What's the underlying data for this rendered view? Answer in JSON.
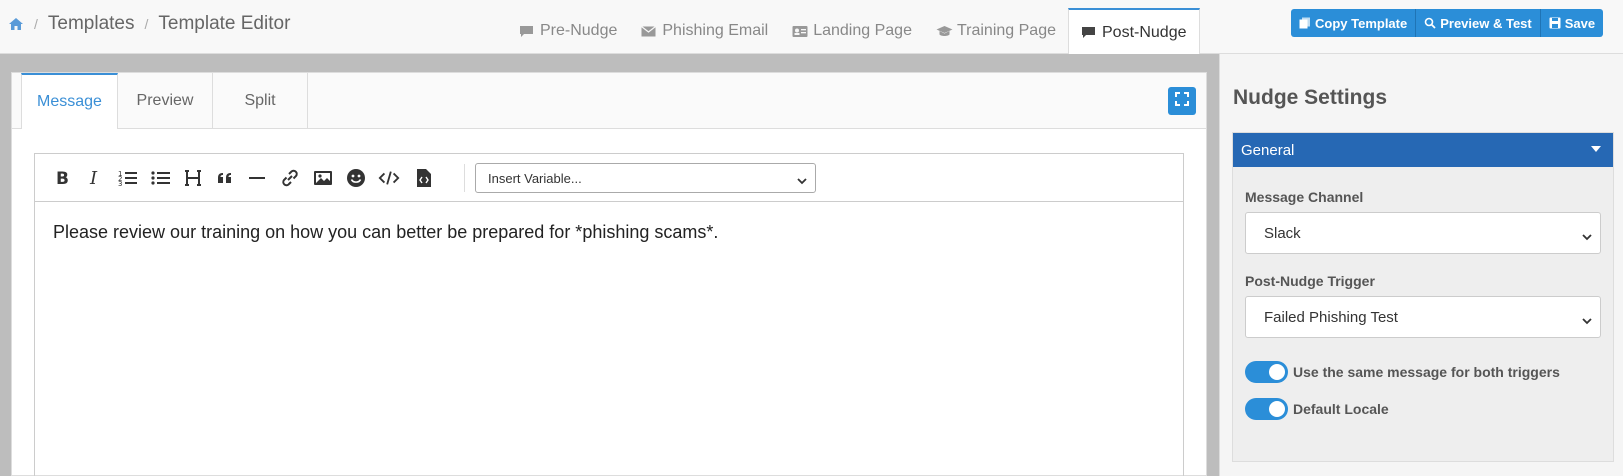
{
  "breadcrumb": {
    "items": [
      "Templates",
      "Template Editor"
    ]
  },
  "tabs": [
    {
      "label": "Pre-Nudge",
      "icon": "comment-icon"
    },
    {
      "label": "Phishing Email",
      "icon": "envelope-icon"
    },
    {
      "label": "Landing Page",
      "icon": "id-card-icon"
    },
    {
      "label": "Training Page",
      "icon": "graduation-cap-icon"
    },
    {
      "label": "Post-Nudge",
      "icon": "comment-icon",
      "active": true
    }
  ],
  "actions": {
    "copy_label": "Copy Template",
    "preview_label": "Preview & Test",
    "save_label": "Save"
  },
  "editor": {
    "subtabs": [
      "Message",
      "Preview",
      "Split"
    ],
    "active_subtab": "Message",
    "variable_placeholder": "Insert Variable...",
    "content": "Please review our training on how you can better be prepared for *phishing scams*.",
    "toolbar_icons": [
      "bold-icon",
      "italic-icon",
      "ordered-list-icon",
      "unordered-list-icon",
      "heading-icon",
      "quote-icon",
      "horizontal-rule-icon",
      "link-icon",
      "image-icon",
      "emoji-icon",
      "code-icon",
      "file-code-icon"
    ]
  },
  "settings": {
    "title": "Nudge Settings",
    "section": "General",
    "message_channel_label": "Message Channel",
    "message_channel_value": "Slack",
    "trigger_label": "Post-Nudge Trigger",
    "trigger_value": "Failed Phishing Test",
    "toggle_same_message": "Use the same message for both triggers",
    "toggle_default_locale": "Default Locale"
  },
  "colors": {
    "accent": "#2b8ed8",
    "section_header": "#2668b4"
  }
}
